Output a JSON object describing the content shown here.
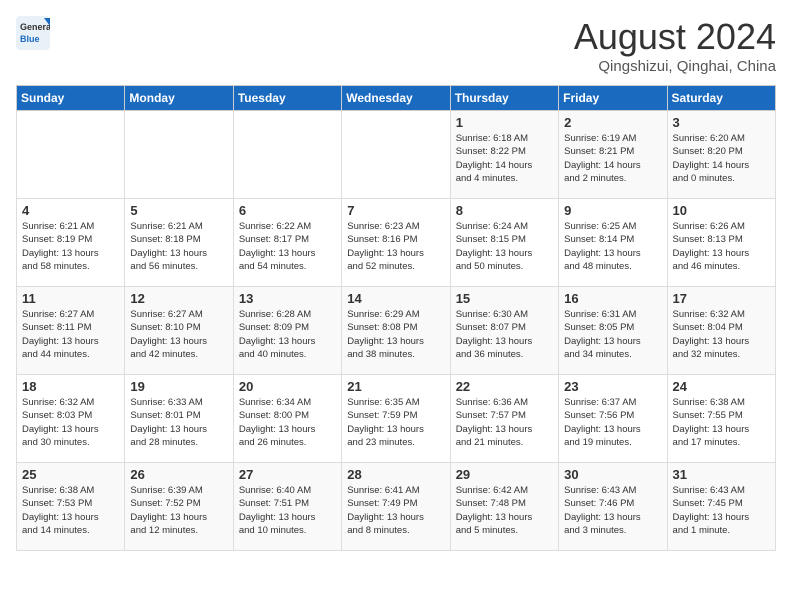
{
  "logo": {
    "general": "General",
    "blue": "Blue"
  },
  "header": {
    "month": "August 2024",
    "location": "Qingshizui, Qinghai, China"
  },
  "weekdays": [
    "Sunday",
    "Monday",
    "Tuesday",
    "Wednesday",
    "Thursday",
    "Friday",
    "Saturday"
  ],
  "weeks": [
    [
      {
        "day": "",
        "info": ""
      },
      {
        "day": "",
        "info": ""
      },
      {
        "day": "",
        "info": ""
      },
      {
        "day": "",
        "info": ""
      },
      {
        "day": "1",
        "info": "Sunrise: 6:18 AM\nSunset: 8:22 PM\nDaylight: 14 hours\nand 4 minutes."
      },
      {
        "day": "2",
        "info": "Sunrise: 6:19 AM\nSunset: 8:21 PM\nDaylight: 14 hours\nand 2 minutes."
      },
      {
        "day": "3",
        "info": "Sunrise: 6:20 AM\nSunset: 8:20 PM\nDaylight: 14 hours\nand 0 minutes."
      }
    ],
    [
      {
        "day": "4",
        "info": "Sunrise: 6:21 AM\nSunset: 8:19 PM\nDaylight: 13 hours\nand 58 minutes."
      },
      {
        "day": "5",
        "info": "Sunrise: 6:21 AM\nSunset: 8:18 PM\nDaylight: 13 hours\nand 56 minutes."
      },
      {
        "day": "6",
        "info": "Sunrise: 6:22 AM\nSunset: 8:17 PM\nDaylight: 13 hours\nand 54 minutes."
      },
      {
        "day": "7",
        "info": "Sunrise: 6:23 AM\nSunset: 8:16 PM\nDaylight: 13 hours\nand 52 minutes."
      },
      {
        "day": "8",
        "info": "Sunrise: 6:24 AM\nSunset: 8:15 PM\nDaylight: 13 hours\nand 50 minutes."
      },
      {
        "day": "9",
        "info": "Sunrise: 6:25 AM\nSunset: 8:14 PM\nDaylight: 13 hours\nand 48 minutes."
      },
      {
        "day": "10",
        "info": "Sunrise: 6:26 AM\nSunset: 8:13 PM\nDaylight: 13 hours\nand 46 minutes."
      }
    ],
    [
      {
        "day": "11",
        "info": "Sunrise: 6:27 AM\nSunset: 8:11 PM\nDaylight: 13 hours\nand 44 minutes."
      },
      {
        "day": "12",
        "info": "Sunrise: 6:27 AM\nSunset: 8:10 PM\nDaylight: 13 hours\nand 42 minutes."
      },
      {
        "day": "13",
        "info": "Sunrise: 6:28 AM\nSunset: 8:09 PM\nDaylight: 13 hours\nand 40 minutes."
      },
      {
        "day": "14",
        "info": "Sunrise: 6:29 AM\nSunset: 8:08 PM\nDaylight: 13 hours\nand 38 minutes."
      },
      {
        "day": "15",
        "info": "Sunrise: 6:30 AM\nSunset: 8:07 PM\nDaylight: 13 hours\nand 36 minutes."
      },
      {
        "day": "16",
        "info": "Sunrise: 6:31 AM\nSunset: 8:05 PM\nDaylight: 13 hours\nand 34 minutes."
      },
      {
        "day": "17",
        "info": "Sunrise: 6:32 AM\nSunset: 8:04 PM\nDaylight: 13 hours\nand 32 minutes."
      }
    ],
    [
      {
        "day": "18",
        "info": "Sunrise: 6:32 AM\nSunset: 8:03 PM\nDaylight: 13 hours\nand 30 minutes."
      },
      {
        "day": "19",
        "info": "Sunrise: 6:33 AM\nSunset: 8:01 PM\nDaylight: 13 hours\nand 28 minutes."
      },
      {
        "day": "20",
        "info": "Sunrise: 6:34 AM\nSunset: 8:00 PM\nDaylight: 13 hours\nand 26 minutes."
      },
      {
        "day": "21",
        "info": "Sunrise: 6:35 AM\nSunset: 7:59 PM\nDaylight: 13 hours\nand 23 minutes."
      },
      {
        "day": "22",
        "info": "Sunrise: 6:36 AM\nSunset: 7:57 PM\nDaylight: 13 hours\nand 21 minutes."
      },
      {
        "day": "23",
        "info": "Sunrise: 6:37 AM\nSunset: 7:56 PM\nDaylight: 13 hours\nand 19 minutes."
      },
      {
        "day": "24",
        "info": "Sunrise: 6:38 AM\nSunset: 7:55 PM\nDaylight: 13 hours\nand 17 minutes."
      }
    ],
    [
      {
        "day": "25",
        "info": "Sunrise: 6:38 AM\nSunset: 7:53 PM\nDaylight: 13 hours\nand 14 minutes."
      },
      {
        "day": "26",
        "info": "Sunrise: 6:39 AM\nSunset: 7:52 PM\nDaylight: 13 hours\nand 12 minutes."
      },
      {
        "day": "27",
        "info": "Sunrise: 6:40 AM\nSunset: 7:51 PM\nDaylight: 13 hours\nand 10 minutes."
      },
      {
        "day": "28",
        "info": "Sunrise: 6:41 AM\nSunset: 7:49 PM\nDaylight: 13 hours\nand 8 minutes."
      },
      {
        "day": "29",
        "info": "Sunrise: 6:42 AM\nSunset: 7:48 PM\nDaylight: 13 hours\nand 5 minutes."
      },
      {
        "day": "30",
        "info": "Sunrise: 6:43 AM\nSunset: 7:46 PM\nDaylight: 13 hours\nand 3 minutes."
      },
      {
        "day": "31",
        "info": "Sunrise: 6:43 AM\nSunset: 7:45 PM\nDaylight: 13 hours\nand 1 minute."
      }
    ]
  ]
}
